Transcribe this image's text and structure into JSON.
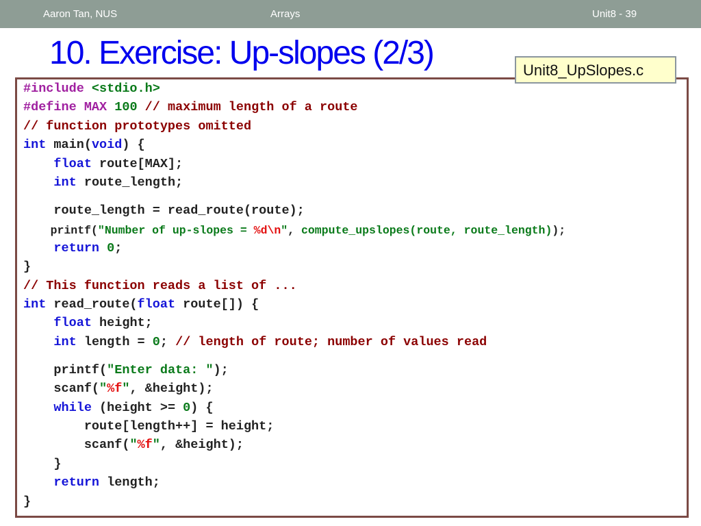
{
  "header": {
    "author": "Aaron Tan, NUS",
    "topic": "Arrays",
    "page": "Unit8 - 39"
  },
  "slide": {
    "title": "10. Exercise: Up-slopes (2/3)",
    "file_label": "Unit8_UpSlopes.c"
  },
  "code": {
    "l1": [
      {
        "t": "#include ",
        "c": "pp"
      },
      {
        "t": "<stdio.h>",
        "c": "str"
      }
    ],
    "l2": [
      {
        "t": "#define ",
        "c": "pp"
      },
      {
        "t": "MAX ",
        "c": "pp"
      },
      {
        "t": "100 ",
        "c": "num"
      },
      {
        "t": "// maximum length of a route",
        "c": "cm"
      }
    ],
    "l3": [
      {
        "t": "// function prototypes omitted",
        "c": "cm"
      }
    ],
    "l4": [
      {
        "t": "int",
        "c": "kw"
      },
      {
        "t": " main(",
        "c": ""
      },
      {
        "t": "void",
        "c": "kw"
      },
      {
        "t": ") {",
        "c": ""
      }
    ],
    "l5": [
      {
        "t": "    ",
        "c": ""
      },
      {
        "t": "float",
        "c": "kw"
      },
      {
        "t": " route[MAX];",
        "c": ""
      }
    ],
    "l6": [
      {
        "t": "    ",
        "c": ""
      },
      {
        "t": "int",
        "c": "kw"
      },
      {
        "t": " route_length;",
        "c": ""
      }
    ],
    "l7": [
      {
        "t": "    route_length = read_route(route);",
        "c": ""
      }
    ],
    "l8": [
      {
        "t": "    printf(",
        "c": ""
      },
      {
        "t": "\"Number of up-slopes = ",
        "c": "str"
      },
      {
        "t": "%d\\n",
        "c": "fmt"
      },
      {
        "t": "\"",
        "c": "str"
      },
      {
        "t": ", ",
        "c": ""
      },
      {
        "t": "compute_upslopes(route, route_length)",
        "c": "str"
      },
      {
        "t": ");",
        "c": ""
      }
    ],
    "l9": [
      {
        "t": "    ",
        "c": ""
      },
      {
        "t": "return",
        "c": "kw"
      },
      {
        "t": " ",
        "c": ""
      },
      {
        "t": "0",
        "c": "num"
      },
      {
        "t": ";",
        "c": ""
      }
    ],
    "l10": [
      {
        "t": "}",
        "c": ""
      }
    ],
    "l11": [
      {
        "t": "// This function reads a list of ...",
        "c": "cm"
      }
    ],
    "l12": [
      {
        "t": "int",
        "c": "kw"
      },
      {
        "t": " read_route(",
        "c": ""
      },
      {
        "t": "float",
        "c": "kw"
      },
      {
        "t": " route[]) {",
        "c": ""
      }
    ],
    "l13": [
      {
        "t": "    ",
        "c": ""
      },
      {
        "t": "float",
        "c": "kw"
      },
      {
        "t": " height;",
        "c": ""
      }
    ],
    "l14": [
      {
        "t": "    ",
        "c": ""
      },
      {
        "t": "int",
        "c": "kw"
      },
      {
        "t": " length = ",
        "c": ""
      },
      {
        "t": "0",
        "c": "num"
      },
      {
        "t": "; ",
        "c": ""
      },
      {
        "t": "// length of route; number of values read",
        "c": "cm"
      }
    ],
    "l15": [
      {
        "t": "    printf(",
        "c": ""
      },
      {
        "t": "\"Enter data: \"",
        "c": "str"
      },
      {
        "t": ");",
        "c": ""
      }
    ],
    "l16": [
      {
        "t": "    scanf(",
        "c": ""
      },
      {
        "t": "\"",
        "c": "str"
      },
      {
        "t": "%f",
        "c": "fmt"
      },
      {
        "t": "\"",
        "c": "str"
      },
      {
        "t": ", &height);",
        "c": ""
      }
    ],
    "l17": [
      {
        "t": "    ",
        "c": ""
      },
      {
        "t": "while",
        "c": "kw"
      },
      {
        "t": " (height >= ",
        "c": ""
      },
      {
        "t": "0",
        "c": "num"
      },
      {
        "t": ") {",
        "c": ""
      }
    ],
    "l18": [
      {
        "t": "        route[length++] = height;",
        "c": ""
      }
    ],
    "l19": [
      {
        "t": "        scanf(",
        "c": ""
      },
      {
        "t": "\"",
        "c": "str"
      },
      {
        "t": "%f",
        "c": "fmt"
      },
      {
        "t": "\"",
        "c": "str"
      },
      {
        "t": ", &height);",
        "c": ""
      }
    ],
    "l20": [
      {
        "t": "    }",
        "c": ""
      }
    ],
    "l21": [
      {
        "t": "    ",
        "c": ""
      },
      {
        "t": "return",
        "c": "kw"
      },
      {
        "t": " length;",
        "c": ""
      }
    ],
    "l22": [
      {
        "t": "}",
        "c": ""
      }
    ]
  },
  "colors": {
    "header_bg": "#8e9d95",
    "title": "#0000ee",
    "keyword": "#1515d8",
    "preprocessor": "#a020a0",
    "string": "#0a7a1a",
    "comment": "#8b0000",
    "format_spec": "#e31010",
    "box_border": "#7b4a45",
    "label_bg": "#ffffcc"
  }
}
